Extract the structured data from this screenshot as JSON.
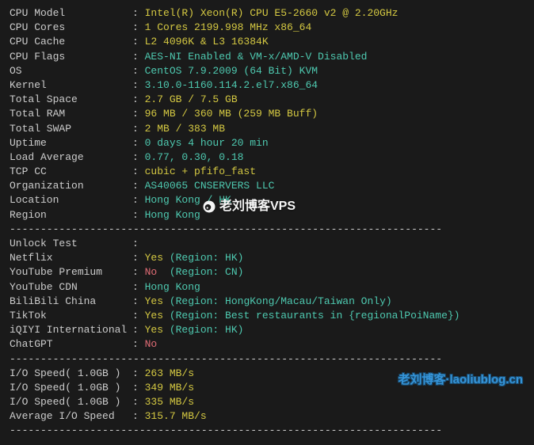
{
  "system": [
    {
      "label": "CPU Model",
      "value": "Intel(R) Xeon(R) CPU E5-2660 v2 @ 2.20GHz",
      "color": "yellow"
    },
    {
      "label": "CPU Cores",
      "value": "1 Cores 2199.998 MHz x86_64",
      "color": "yellow"
    },
    {
      "label": "CPU Cache",
      "value": "L2 4096K & L3 16384K",
      "color": "yellow"
    },
    {
      "label": "CPU Flags",
      "value": "AES-NI Enabled & VM-x/AMD-V Disabled",
      "color": "cyan"
    },
    {
      "label": "OS",
      "value": "CentOS 7.9.2009 (64 Bit) KVM",
      "color": "cyan"
    },
    {
      "label": "Kernel",
      "value": "3.10.0-1160.114.2.el7.x86_64",
      "color": "cyan"
    },
    {
      "label": "Total Space",
      "value": "2.7 GB / 7.5 GB",
      "color": "yellow"
    },
    {
      "label": "Total RAM",
      "value": "96 MB / 360 MB (259 MB Buff)",
      "color": "yellow"
    },
    {
      "label": "Total SWAP",
      "value": "2 MB / 383 MB",
      "color": "yellow"
    },
    {
      "label": "Uptime",
      "value": "0 days 4 hour 20 min",
      "color": "cyan"
    },
    {
      "label": "Load Average",
      "value": "0.77, 0.30, 0.18",
      "color": "cyan"
    },
    {
      "label": "TCP CC",
      "value": "cubic + pfifo_fast",
      "color": "yellow"
    },
    {
      "label": "Organization",
      "value": "AS40065 CNSERVERS LLC",
      "color": "cyan"
    },
    {
      "label": "Location",
      "value": "Hong Kong / HK",
      "color": "cyan"
    },
    {
      "label": "Region",
      "value": "Hong Kong",
      "color": "cyan"
    }
  ],
  "unlock_header": "Unlock Test",
  "unlock": [
    {
      "label": "Netflix",
      "status": "Yes",
      "status_color": "yellow",
      "extra": "(Region: HK)",
      "extra_color": "cyan"
    },
    {
      "label": "YouTube Premium",
      "status": "No ",
      "status_color": "red",
      "extra": "(Region: CN)",
      "extra_color": "cyan"
    },
    {
      "label": "YouTube CDN",
      "status": "",
      "status_color": "",
      "extra": "Hong Kong",
      "extra_color": "cyan"
    },
    {
      "label": "BiliBili China",
      "status": "Yes",
      "status_color": "yellow",
      "extra": "(Region: HongKong/Macau/Taiwan Only)",
      "extra_color": "cyan"
    },
    {
      "label": "TikTok",
      "status": "Yes",
      "status_color": "yellow",
      "extra": "(Region: Best restaurants in {regionalPoiName})",
      "extra_color": "cyan"
    },
    {
      "label": "iQIYI International",
      "status": "Yes",
      "status_color": "yellow",
      "extra": "(Region: HK)",
      "extra_color": "cyan"
    },
    {
      "label": "ChatGPT",
      "status": "No",
      "status_color": "red",
      "extra": "",
      "extra_color": ""
    }
  ],
  "io": [
    {
      "label": "I/O Speed( 1.0GB )",
      "value": "263 MB/s",
      "color": "yellow"
    },
    {
      "label": "I/O Speed( 1.0GB )",
      "value": "349 MB/s",
      "color": "yellow"
    },
    {
      "label": "I/O Speed( 1.0GB )",
      "value": "335 MB/s",
      "color": "yellow"
    },
    {
      "label": "Average I/O Speed",
      "value": "315.7 MB/s",
      "color": "yellow"
    }
  ],
  "watermark1": "老刘博客VPS",
  "watermark2": "老刘博客·laoliublog.cn",
  "divider": "----------------------------------------------------------------------"
}
